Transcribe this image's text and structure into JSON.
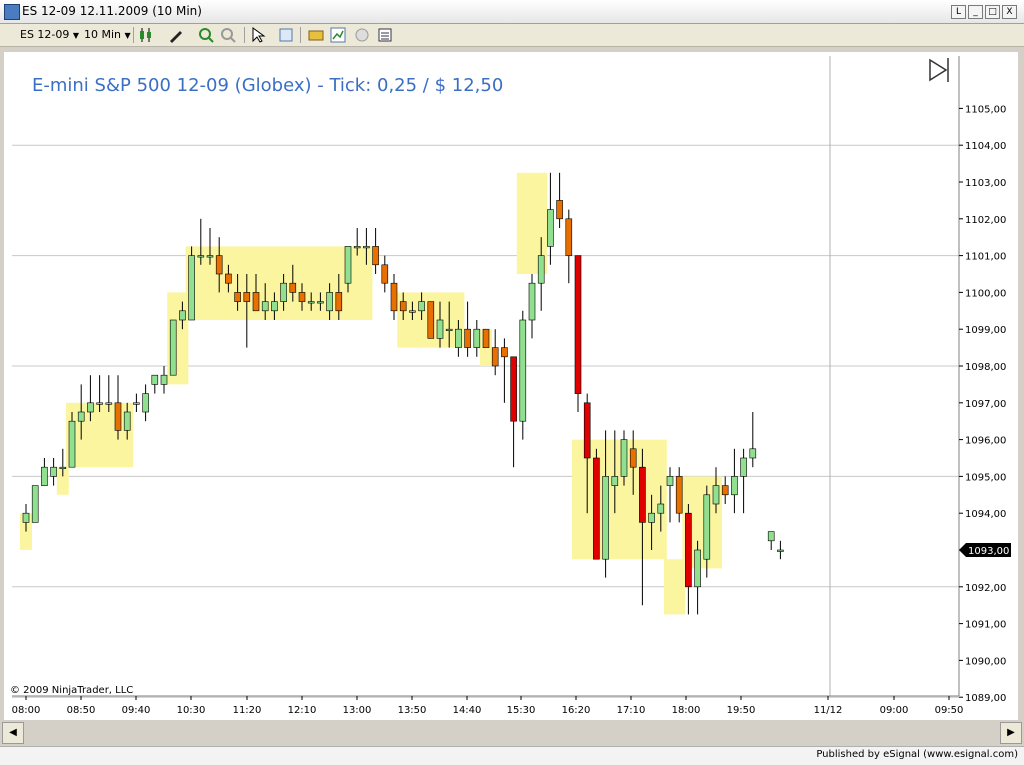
{
  "window": {
    "title": "ES 12-09  12.11.2009 (10 Min)",
    "buttons": [
      "L",
      "_",
      "□",
      "X"
    ]
  },
  "toolbar": {
    "instrument": "ES 12-09",
    "interval": "10 Min"
  },
  "chart_header": {
    "text": "E-mini S&P 500 12-09  (Globex)  -  Tick: 0,25  /  $ 12,50",
    "color": "#3a6fc4"
  },
  "copyright": "© 2009 NinjaTrader, LLC",
  "publisher": "Published by eSignal (www.esignal.com)",
  "current_price_label": "1093,00",
  "chart_data": {
    "type": "candlestick",
    "instrument": "ES 12-09",
    "interval": "10 Min",
    "ylim": [
      1088.75,
      1105.5
    ],
    "y_ticks": [
      "1105,00",
      "1104,00",
      "1103,00",
      "1102,00",
      "1101,00",
      "1100,00",
      "1099,00",
      "1098,00",
      "1097,00",
      "1096,00",
      "1095,00",
      "1094,00",
      "1093,00",
      "1092,00",
      "1091,00",
      "1090,00",
      "1089,00"
    ],
    "x_tick_labels": [
      "08:00",
      "08:50",
      "09:40",
      "10:30",
      "11:20",
      "12:10",
      "13:00",
      "13:50",
      "14:40",
      "15:30",
      "16:20",
      "17:10",
      "18:00",
      "19:50",
      "11/12",
      "09:00",
      "09:50"
    ],
    "last_price": 1093.0,
    "candles": [
      {
        "o": 1093.75,
        "h": 1094.25,
        "l": 1093.5,
        "c": 1094.0
      },
      {
        "o": 1093.75,
        "h": 1094.75,
        "l": 1093.75,
        "c": 1094.75
      },
      {
        "o": 1094.75,
        "h": 1095.5,
        "l": 1094.75,
        "c": 1095.25
      },
      {
        "o": 1095.0,
        "h": 1095.5,
        "l": 1094.75,
        "c": 1095.25
      },
      {
        "o": 1095.25,
        "h": 1095.75,
        "l": 1095.0,
        "c": 1095.25
      },
      {
        "o": 1095.25,
        "h": 1096.75,
        "l": 1095.25,
        "c": 1096.5
      },
      {
        "o": 1096.5,
        "h": 1097.5,
        "l": 1096.0,
        "c": 1096.75
      },
      {
        "o": 1096.75,
        "h": 1097.75,
        "l": 1096.5,
        "c": 1097.0
      },
      {
        "o": 1097.0,
        "h": 1097.75,
        "l": 1096.75,
        "c": 1097.0
      },
      {
        "o": 1097.0,
        "h": 1097.75,
        "l": 1096.75,
        "c": 1097.0
      },
      {
        "o": 1097.0,
        "h": 1097.75,
        "l": 1096.0,
        "c": 1096.25
      },
      {
        "o": 1096.25,
        "h": 1097.0,
        "l": 1096.0,
        "c": 1096.75
      },
      {
        "o": 1097.0,
        "h": 1097.25,
        "l": 1096.75,
        "c": 1097.0
      },
      {
        "o": 1096.75,
        "h": 1097.5,
        "l": 1096.5,
        "c": 1097.25
      },
      {
        "o": 1097.5,
        "h": 1097.75,
        "l": 1097.25,
        "c": 1097.75
      },
      {
        "o": 1097.5,
        "h": 1098.0,
        "l": 1097.25,
        "c": 1097.75
      },
      {
        "o": 1097.75,
        "h": 1099.25,
        "l": 1097.75,
        "c": 1099.25
      },
      {
        "o": 1099.25,
        "h": 1099.75,
        "l": 1099.0,
        "c": 1099.5
      },
      {
        "o": 1099.25,
        "h": 1101.25,
        "l": 1099.25,
        "c": 1101.0
      },
      {
        "o": 1101.0,
        "h": 1102.0,
        "l": 1100.75,
        "c": 1101.0
      },
      {
        "o": 1101.0,
        "h": 1101.75,
        "l": 1100.75,
        "c": 1101.0
      },
      {
        "o": 1101.0,
        "h": 1101.5,
        "l": 1100.0,
        "c": 1100.5
      },
      {
        "o": 1100.5,
        "h": 1100.75,
        "l": 1100.0,
        "c": 1100.25
      },
      {
        "o": 1100.0,
        "h": 1100.5,
        "l": 1099.5,
        "c": 1099.75
      },
      {
        "o": 1100.0,
        "h": 1100.5,
        "l": 1098.5,
        "c": 1099.75
      },
      {
        "o": 1100.0,
        "h": 1100.5,
        "l": 1099.5,
        "c": 1099.5
      },
      {
        "o": 1099.5,
        "h": 1100.25,
        "l": 1099.25,
        "c": 1099.75
      },
      {
        "o": 1099.5,
        "h": 1100.0,
        "l": 1099.25,
        "c": 1099.75
      },
      {
        "o": 1099.75,
        "h": 1100.5,
        "l": 1099.5,
        "c": 1100.25
      },
      {
        "o": 1100.25,
        "h": 1100.75,
        "l": 1099.75,
        "c": 1100.0
      },
      {
        "o": 1100.0,
        "h": 1100.25,
        "l": 1099.5,
        "c": 1099.75
      },
      {
        "o": 1099.75,
        "h": 1100.0,
        "l": 1099.5,
        "c": 1099.75
      },
      {
        "o": 1099.75,
        "h": 1100.0,
        "l": 1099.5,
        "c": 1099.75
      },
      {
        "o": 1099.5,
        "h": 1100.25,
        "l": 1099.25,
        "c": 1100.0
      },
      {
        "o": 1100.0,
        "h": 1100.5,
        "l": 1099.25,
        "c": 1099.5
      },
      {
        "o": 1100.25,
        "h": 1101.25,
        "l": 1100.0,
        "c": 1101.25
      },
      {
        "o": 1101.25,
        "h": 1101.75,
        "l": 1101.0,
        "c": 1101.25
      },
      {
        "o": 1101.25,
        "h": 1101.75,
        "l": 1100.75,
        "c": 1101.25
      },
      {
        "o": 1101.25,
        "h": 1101.75,
        "l": 1100.5,
        "c": 1100.75
      },
      {
        "o": 1100.75,
        "h": 1101.0,
        "l": 1100.0,
        "c": 1100.25
      },
      {
        "o": 1100.25,
        "h": 1100.5,
        "l": 1099.25,
        "c": 1099.5
      },
      {
        "o": 1099.75,
        "h": 1100.0,
        "l": 1099.25,
        "c": 1099.5
      },
      {
        "o": 1099.5,
        "h": 1099.75,
        "l": 1099.25,
        "c": 1099.5
      },
      {
        "o": 1099.5,
        "h": 1100.0,
        "l": 1099.25,
        "c": 1099.75
      },
      {
        "o": 1099.75,
        "h": 1099.75,
        "l": 1098.75,
        "c": 1098.75
      },
      {
        "o": 1098.75,
        "h": 1099.75,
        "l": 1098.5,
        "c": 1099.25
      },
      {
        "o": 1099.0,
        "h": 1099.75,
        "l": 1098.5,
        "c": 1099.0
      },
      {
        "o": 1098.5,
        "h": 1099.25,
        "l": 1098.25,
        "c": 1099.0
      },
      {
        "o": 1099.0,
        "h": 1099.75,
        "l": 1098.25,
        "c": 1098.5
      },
      {
        "o": 1098.5,
        "h": 1099.25,
        "l": 1098.25,
        "c": 1099.0
      },
      {
        "o": 1099.0,
        "h": 1099.0,
        "l": 1098.5,
        "c": 1098.5
      },
      {
        "o": 1098.5,
        "h": 1099.0,
        "l": 1097.75,
        "c": 1098.0
      },
      {
        "o": 1098.5,
        "h": 1098.75,
        "l": 1097.0,
        "c": 1098.25
      },
      {
        "o": 1098.25,
        "h": 1098.25,
        "l": 1095.25,
        "c": 1096.5
      },
      {
        "o": 1096.5,
        "h": 1099.5,
        "l": 1096.0,
        "c": 1099.25
      },
      {
        "o": 1099.25,
        "h": 1100.5,
        "l": 1098.75,
        "c": 1100.25
      },
      {
        "o": 1100.25,
        "h": 1101.5,
        "l": 1099.5,
        "c": 1101.0
      },
      {
        "o": 1101.25,
        "h": 1103.25,
        "l": 1100.75,
        "c": 1102.25
      },
      {
        "o": 1102.5,
        "h": 1103.25,
        "l": 1101.75,
        "c": 1102.0
      },
      {
        "o": 1102.0,
        "h": 1102.25,
        "l": 1100.25,
        "c": 1101.0
      },
      {
        "o": 1101.0,
        "h": 1101.0,
        "l": 1096.75,
        "c": 1097.25
      },
      {
        "o": 1097.0,
        "h": 1097.25,
        "l": 1094.0,
        "c": 1095.5
      },
      {
        "o": 1095.5,
        "h": 1095.75,
        "l": 1092.75,
        "c": 1092.75
      },
      {
        "o": 1092.75,
        "h": 1096.25,
        "l": 1092.25,
        "c": 1095.0
      },
      {
        "o": 1094.75,
        "h": 1096.25,
        "l": 1094.0,
        "c": 1095.0
      },
      {
        "o": 1095.0,
        "h": 1096.25,
        "l": 1094.75,
        "c": 1096.0
      },
      {
        "o": 1095.75,
        "h": 1096.25,
        "l": 1094.5,
        "c": 1095.25
      },
      {
        "o": 1095.25,
        "h": 1095.75,
        "l": 1091.5,
        "c": 1093.75
      },
      {
        "o": 1093.75,
        "h": 1094.5,
        "l": 1093.0,
        "c": 1094.0
      },
      {
        "o": 1094.0,
        "h": 1094.75,
        "l": 1093.5,
        "c": 1094.25
      },
      {
        "o": 1094.75,
        "h": 1095.25,
        "l": 1093.75,
        "c": 1095.0
      },
      {
        "o": 1095.0,
        "h": 1095.25,
        "l": 1093.75,
        "c": 1094.0
      },
      {
        "o": 1094.0,
        "h": 1094.25,
        "l": 1091.25,
        "c": 1092.0
      },
      {
        "o": 1092.0,
        "h": 1093.25,
        "l": 1091.25,
        "c": 1093.0
      },
      {
        "o": 1092.75,
        "h": 1094.75,
        "l": 1092.25,
        "c": 1094.5
      },
      {
        "o": 1094.25,
        "h": 1095.25,
        "l": 1094.0,
        "c": 1094.75
      },
      {
        "o": 1094.75,
        "h": 1095.0,
        "l": 1094.25,
        "c": 1094.5
      },
      {
        "o": 1094.5,
        "h": 1095.75,
        "l": 1094.0,
        "c": 1095.0
      },
      {
        "o": 1095.0,
        "h": 1095.75,
        "l": 1094.0,
        "c": 1095.5
      },
      {
        "o": 1095.5,
        "h": 1096.75,
        "l": 1095.25,
        "c": 1095.75
      },
      null,
      {
        "o": 1093.25,
        "h": 1093.5,
        "l": 1093.0,
        "c": 1093.5
      },
      {
        "o": 1093.0,
        "h": 1093.25,
        "l": 1092.75,
        "c": 1093.0
      }
    ],
    "zones": [
      {
        "from": 0,
        "to": 0,
        "low": 1093.0,
        "high": 1094.0
      },
      {
        "from": 4,
        "to": 4,
        "low": 1094.5,
        "high": 1095.25
      },
      {
        "from": 5,
        "to": 11,
        "low": 1095.25,
        "high": 1097.0
      },
      {
        "from": 16,
        "to": 17,
        "low": 1097.5,
        "high": 1100.0
      },
      {
        "from": 18,
        "to": 37,
        "low": 1099.25,
        "high": 1101.25
      },
      {
        "from": 41,
        "to": 47,
        "low": 1098.5,
        "high": 1100.0
      },
      {
        "from": 50,
        "to": 50,
        "low": 1098.0,
        "high": 1099.0
      },
      {
        "from": 54,
        "to": 56,
        "low": 1100.5,
        "high": 1103.25
      },
      {
        "from": 60,
        "to": 69,
        "low": 1092.75,
        "high": 1096.0
      },
      {
        "from": 70,
        "to": 71,
        "low": 1091.25,
        "high": 1092.75
      },
      {
        "from": 72,
        "to": 75,
        "low": 1092.5,
        "high": 1095.0
      }
    ],
    "colors": {
      "up_body": "#90e090",
      "down_body": "#e87000",
      "strong_down_body": "#e00000",
      "zone": "#fbf5a0",
      "grid": "#c8c8c8",
      "wick": "#000000"
    }
  }
}
